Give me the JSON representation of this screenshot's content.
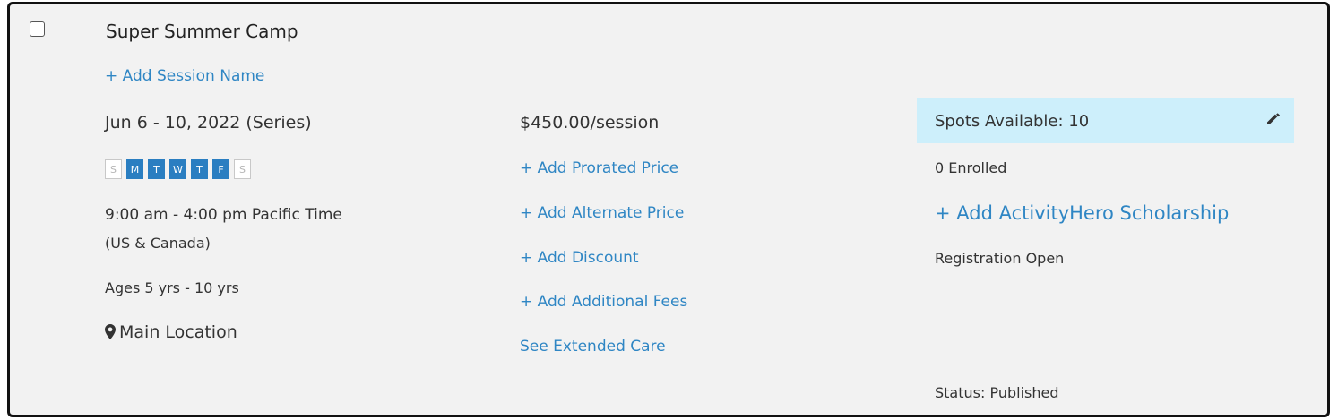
{
  "session": {
    "title": "Super Summer Camp",
    "add_session_name": "+ Add Session Name",
    "dates": "Jun 6 - 10, 2022 (Series)",
    "days": [
      {
        "letter": "S",
        "active": false
      },
      {
        "letter": "M",
        "active": true
      },
      {
        "letter": "T",
        "active": true
      },
      {
        "letter": "W",
        "active": true
      },
      {
        "letter": "T",
        "active": true
      },
      {
        "letter": "F",
        "active": true
      },
      {
        "letter": "S",
        "active": false
      }
    ],
    "time_line1": "9:00 am - 4:00 pm Pacific Time",
    "time_line2": "(US & Canada)",
    "ages": "Ages 5 yrs - 10 yrs",
    "location": "Main Location"
  },
  "pricing": {
    "price": "$450.00/session",
    "add_prorated": "+ Add Prorated Price",
    "add_alternate": "+ Add Alternate Price",
    "add_discount": "+ Add Discount",
    "add_fees": "+ Add Additional Fees",
    "extended_care": "See Extended Care"
  },
  "status": {
    "spots": "Spots Available: 10",
    "enrolled": "0 Enrolled",
    "add_scholarship": "+ Add ActivityHero Scholarship",
    "registration": "Registration Open",
    "published": "Status: Published"
  },
  "icons": {
    "pencil": "pencil-icon",
    "location": "map-marker-icon"
  },
  "colors": {
    "link": "#2f86c4",
    "day_active": "#2a7ec1",
    "spots_bg": "#cdeffb",
    "card_bg": "#f2f2f2"
  }
}
